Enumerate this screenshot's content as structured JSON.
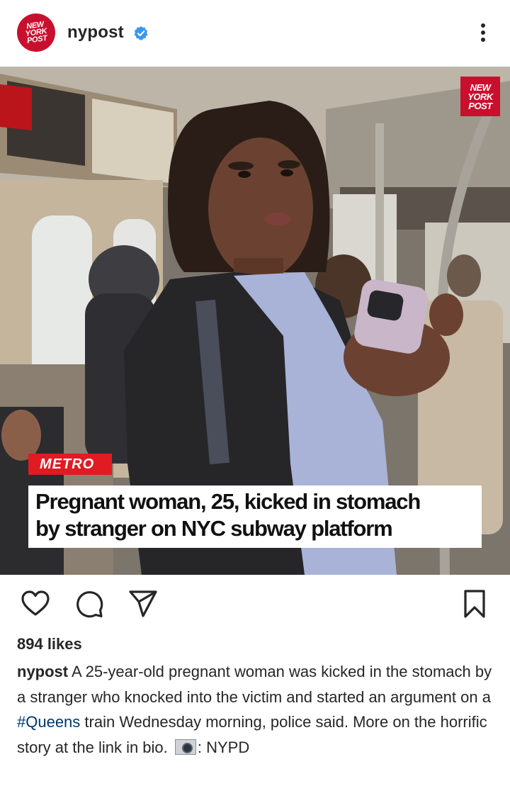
{
  "header": {
    "username": "nypost",
    "avatar_lines": [
      "NEW",
      "YORK",
      "POST"
    ],
    "verified_icon": "verified-badge-icon",
    "more_icon": "more-options-icon"
  },
  "post_image": {
    "logo_lines": [
      "NEW",
      "YORK",
      "POST"
    ],
    "section_tag": "METRO",
    "headline_line1": "Pregnant woman, 25, kicked in stomach",
    "headline_line2": "by stranger on NYC subway platform"
  },
  "actions": {
    "icons": [
      "heart-icon",
      "comment-icon",
      "share-icon",
      "bookmark-icon"
    ]
  },
  "likes": "894 likes",
  "caption": {
    "username": "nypost",
    "text_before_hashtag": " A 25-year-old pregnant woman was kicked in the stomach by a stranger who knocked into the victim and started an argument on a ",
    "hashtag": "#Queens",
    "text_after_hashtag": " train Wednesday morning, police said. More on the horrific story at the link in bio. ",
    "credit": ": NYPD"
  },
  "colors": {
    "brand_red": "#c8102e",
    "metro_red": "#e11b22",
    "verified_blue": "#3897f0",
    "hashtag_blue": "#00376b",
    "text": "#262626"
  }
}
